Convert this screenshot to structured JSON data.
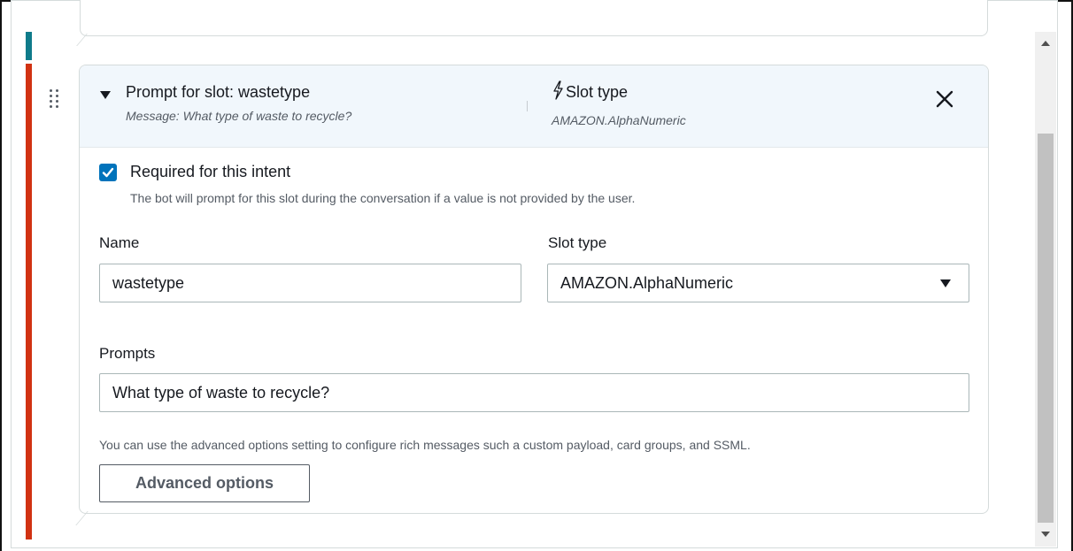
{
  "slot": {
    "prompt_title": "Prompt for slot: wastetype",
    "prompt_message": "Message: What type of waste to recycle?",
    "slot_type_title": "Slot type",
    "slot_type_value": "AMAZON.AlphaNumeric"
  },
  "required": {
    "checked": true,
    "label": "Required for this intent",
    "description": "The bot will prompt for this slot during the conversation if a value is not provided by the user."
  },
  "name_field": {
    "label": "Name",
    "value": "wastetype"
  },
  "slot_type_field": {
    "label": "Slot type",
    "value": "AMAZON.AlphaNumeric"
  },
  "prompts_field": {
    "label": "Prompts",
    "value": "What type of waste to recycle?"
  },
  "advanced": {
    "description": "You can use the advanced options setting to configure rich messages such a custom payload, card groups, and SSML.",
    "button_label": "Advanced options"
  },
  "icons": {
    "drag": "drag-handle-icon",
    "collapse": "caret-down-icon",
    "slot_type": "lightning-bolt-icon",
    "close": "close-icon",
    "checkbox": "checkmark-icon",
    "select": "caret-down-icon"
  },
  "colors": {
    "header_bg": "#f1f7fc",
    "accent_blue": "#0073bb",
    "error_bar": "#d13212",
    "teal_bar": "#0f7b8a"
  }
}
